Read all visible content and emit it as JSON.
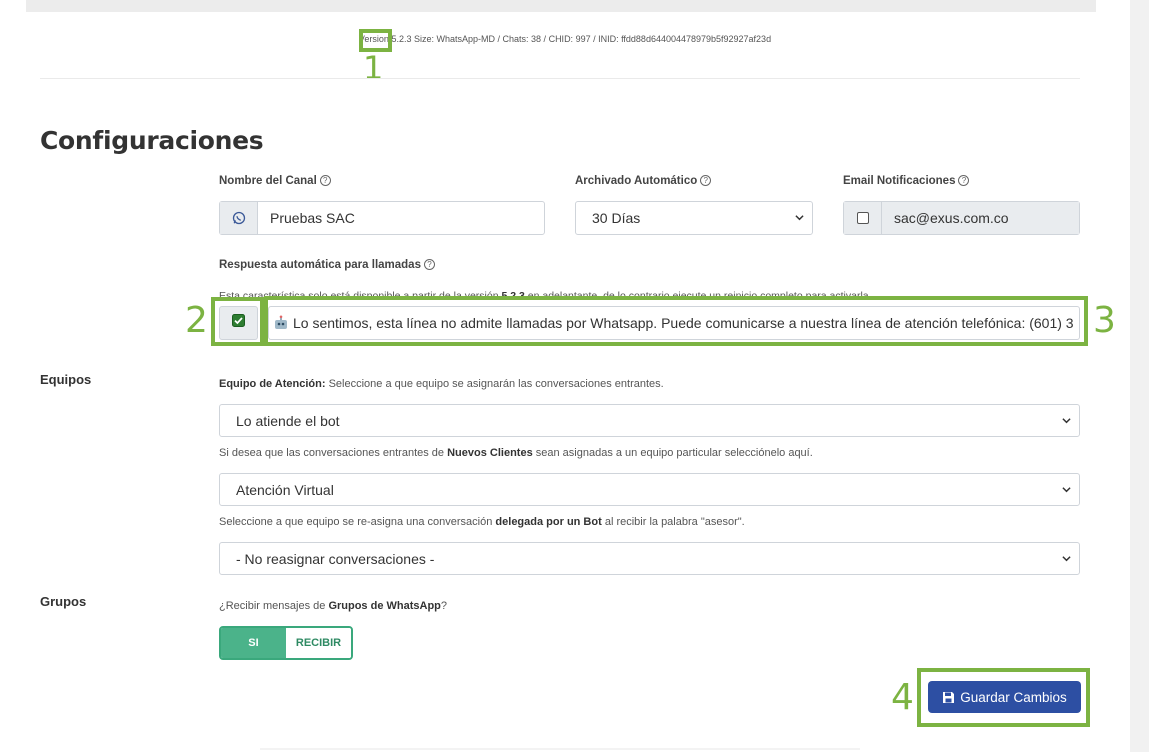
{
  "header": {
    "version_prefix": "Version",
    "version_number": "5.2.3",
    "version_suffix": "Size: WhatsApp-MD / Chats: 38 / CHID: 997 / INID: ffdd88d644004478979b5f92927af23d"
  },
  "annotations": [
    "1",
    "2",
    "3",
    "4"
  ],
  "page_title": "Configuraciones",
  "channel": {
    "name_label": "Nombre del Canal",
    "name_value": "Pruebas SAC",
    "archive_label": "Archivado Automático",
    "archive_value": "30 Días",
    "email_label": "Email Notificaciones",
    "email_checked": false,
    "email_value": "sac@exus.com.co"
  },
  "calls": {
    "label": "Respuesta automática para llamadas",
    "note_prefix": "Esta característica solo está disponible a partir de la versión",
    "note_version": "5.2.3",
    "note_suffix": "en adelantante, de lo contrario ejecute un reinicio completo para activarla",
    "checked": true,
    "message": "Lo sentimos, esta línea no admite llamadas por Whatsapp. Puede comunicarse a nuestra línea de atención telefónica: (601) 3"
  },
  "teams": {
    "section_label": "Equipos",
    "team_label_bold": "Equipo de Atención:",
    "team_label_rest": "Seleccione a que equipo se asignarán las conversaciones entrantes.",
    "team_value": "Lo atiende el bot",
    "new_clients_prefix": "Si desea que las conversaciones entrantes de",
    "new_clients_bold": "Nuevos Clientes",
    "new_clients_suffix": "sean asignadas a un equipo particular selecciónelo aquí.",
    "new_clients_value": "Atención Virtual",
    "reassign_prefix": "Seleccione a que equipo se re-asigna una conversación",
    "reassign_bold": "delegada por un Bot",
    "reassign_suffix": "al recibir la palabra \"asesor\".",
    "reassign_value": "- No reasignar conversaciones -"
  },
  "groups": {
    "section_label": "Grupos",
    "question_prefix": "¿Recibir mensajes de",
    "question_bold": "Grupos de WhatsApp",
    "question_suffix": "?",
    "toggle_on": "SI",
    "toggle_off": "RECIBIR"
  },
  "save_button": {
    "label": "Guardar Cambios"
  },
  "colors": {
    "annotation": "#7cb342",
    "primary_button": "#2d4fa3",
    "toggle_on": "#4bb38a",
    "checkbox_check": "#2e7d32"
  }
}
